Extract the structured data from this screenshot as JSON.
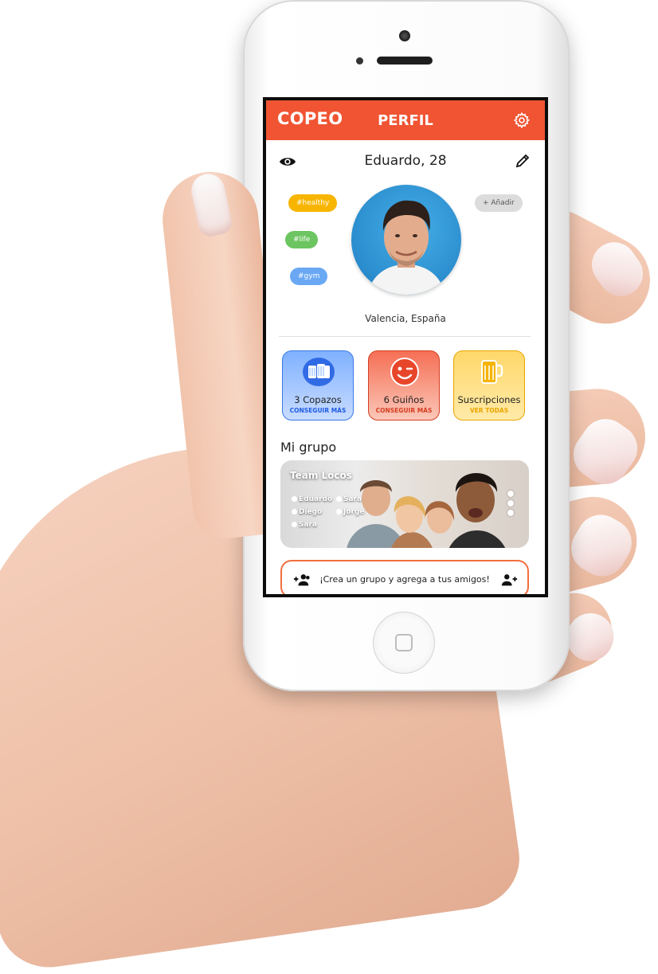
{
  "app": {
    "brand": "COPEO",
    "page_title": "PERFIL"
  },
  "profile": {
    "name": "Eduardo, 28",
    "location": "Valencia, España",
    "tags": [
      "#healthy",
      "#life",
      "#gym"
    ],
    "add_tag_label": "+ Añadir"
  },
  "cards": [
    {
      "title": "3 Copazos",
      "link": "CONSEGUIR MÁS",
      "icon": "beer-mugs-icon",
      "color": "#3a78e6"
    },
    {
      "title": "6 Guiños",
      "link": "CONSEGUIR MÁS",
      "icon": "wink-face-icon",
      "color": "#d43d22"
    },
    {
      "title": "Suscripciones",
      "link": "VER TODAS",
      "icon": "beer-mug-icon",
      "color": "#e9a500"
    }
  ],
  "group_section": {
    "title": "Mi grupo",
    "group_name": "Team Locos",
    "members": [
      "Eduardo",
      "Sara",
      "Diego",
      "Jorge",
      "Sara"
    ]
  },
  "cta": {
    "label": "¡Crea un grupo y agrega a tus amigos!"
  },
  "colors": {
    "accent": "#f05432",
    "tag_healthy": "#f7b500",
    "tag_life": "#6cc560",
    "tag_gym": "#6aa8f4"
  }
}
